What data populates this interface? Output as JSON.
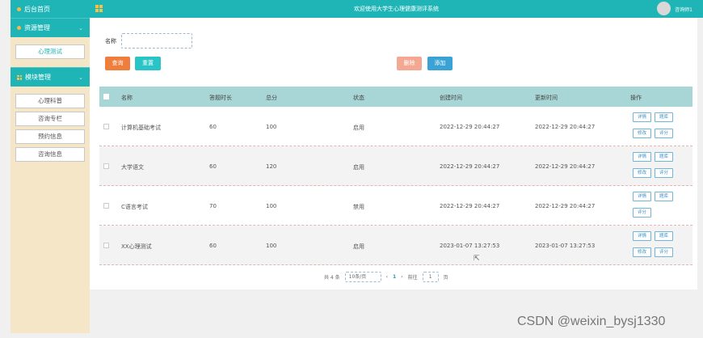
{
  "sidebar": {
    "home": "后台首页",
    "resource_group": "资源管理",
    "resource_items": [
      "心理测试"
    ],
    "module_group": "模块管理",
    "module_items": [
      "心理科普",
      "咨询专栏",
      "预约信息",
      "咨询信息"
    ]
  },
  "header": {
    "title": "欢迎使用大学生心理健康测评系统",
    "user": "咨询师1"
  },
  "search": {
    "label": "名称",
    "value": "",
    "placeholder": ""
  },
  "buttons": {
    "query": "查询",
    "reset": "重置",
    "delete": "删除",
    "add": "添加"
  },
  "table": {
    "columns": [
      "名称",
      "答题时长",
      "总分",
      "状态",
      "创建时间",
      "更新时间",
      "操作"
    ],
    "rows": [
      {
        "name": "计算机基础考试",
        "duration": "60",
        "score": "100",
        "status": "启用",
        "created": "2022-12-29 20:44:27",
        "updated": "2022-12-29 20:44:27",
        "actions": [
          "详情",
          "题库",
          "修改",
          "评分"
        ]
      },
      {
        "name": "大学语文",
        "duration": "60",
        "score": "120",
        "status": "启用",
        "created": "2022-12-29 20:44:27",
        "updated": "2022-12-29 20:44:27",
        "actions": [
          "详情",
          "题库",
          "修改",
          "评分"
        ]
      },
      {
        "name": "C语言考试",
        "duration": "70",
        "score": "100",
        "status": "禁用",
        "created": "2022-12-29 20:44:27",
        "updated": "2022-12-29 20:44:27",
        "actions": [
          "详情",
          "题库",
          "评分"
        ]
      },
      {
        "name": "XX心理测试",
        "duration": "60",
        "score": "100",
        "status": "启用",
        "created": "2023-01-07 13:27:53",
        "updated": "2023-01-07 13:27:53",
        "actions": [
          "详情",
          "题库",
          "修改",
          "评分"
        ]
      }
    ]
  },
  "pager": {
    "total": "共 4 条",
    "page_size": "10条/页",
    "prev": "‹",
    "current": "1",
    "next": "›",
    "goto": "前往",
    "goto_value": "1",
    "page_suffix": "页"
  },
  "watermark": "CSDN @weixin_bysj1330"
}
